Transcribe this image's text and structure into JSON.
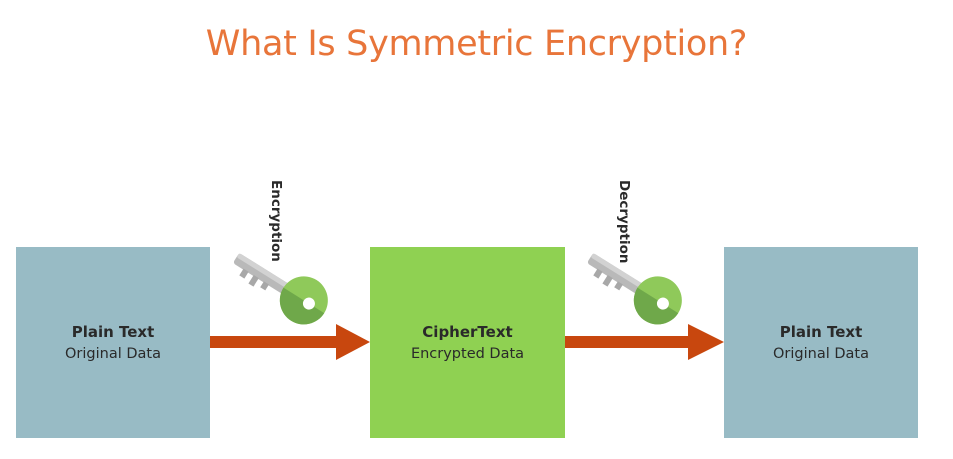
{
  "title": "What Is Symmetric Encryption?",
  "boxes": {
    "plain_left": {
      "heading": "Plain Text",
      "subtitle": "Original Data"
    },
    "cipher": {
      "heading": "CipherText",
      "subtitle": "Encrypted Data"
    },
    "plain_right": {
      "heading": "Plain Text",
      "subtitle": "Original Data"
    }
  },
  "keys": {
    "encryption_label": "Encryption",
    "decryption_label": "Decryption"
  },
  "colors": {
    "title": "#e8753a",
    "plain_box": "#98bbc5",
    "cipher_box": "#8fd152",
    "arrow": "#c8470e",
    "key_head": "#8fc95a",
    "key_shaft": "#b9b9b9"
  },
  "icons": [
    "key-icon",
    "arrow-right-icon"
  ]
}
